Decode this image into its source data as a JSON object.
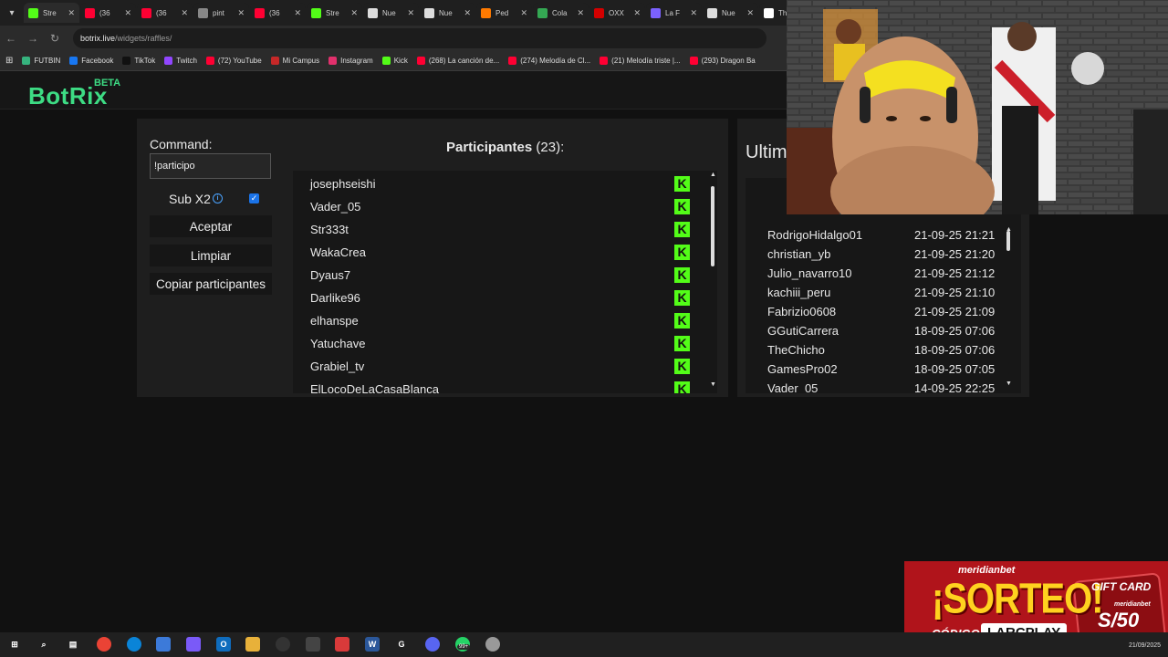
{
  "browser": {
    "tabs": [
      {
        "title": "Stre",
        "icon": "kick-icon",
        "color": "#53fc18"
      },
      {
        "title": "(36",
        "icon": "youtube-icon",
        "color": "#ff0033"
      },
      {
        "title": "(36",
        "icon": "youtube-icon",
        "color": "#ff0033"
      },
      {
        "title": "pint",
        "icon": "globe-icon",
        "color": "#888888"
      },
      {
        "title": "(36",
        "icon": "youtube-icon",
        "color": "#ff0033"
      },
      {
        "title": "Stre",
        "icon": "kick-icon",
        "color": "#53fc18"
      },
      {
        "title": "Nue",
        "icon": "github-icon",
        "color": "#dddddd"
      },
      {
        "title": "Nue",
        "icon": "github-icon",
        "color": "#dddddd"
      },
      {
        "title": "Ped",
        "icon": "order-icon",
        "color": "#ff7a00"
      },
      {
        "title": "Cola",
        "icon": "chart-icon",
        "color": "#34a853"
      },
      {
        "title": "OXX",
        "icon": "oxxo-icon",
        "color": "#d40000"
      },
      {
        "title": "La F",
        "icon": "globe-icon",
        "color": "#7b61ff"
      },
      {
        "title": "Nue",
        "icon": "github-icon",
        "color": "#dddddd"
      },
      {
        "title": "The",
        "icon": "diamond-icon",
        "color": "#ffffff"
      }
    ],
    "url_domain": "botrix.live",
    "url_path": "/widgets/raffles/",
    "bookmarks": [
      {
        "label": "FUTBIN",
        "color": "#36b37e"
      },
      {
        "label": "Facebook",
        "color": "#1877f2"
      },
      {
        "label": "TikTok",
        "color": "#111111"
      },
      {
        "label": "Twitch",
        "color": "#9146ff"
      },
      {
        "label": "(72) YouTube",
        "color": "#ff0033"
      },
      {
        "label": "Mi Campus",
        "color": "#c62828"
      },
      {
        "label": "Instagram",
        "color": "#e1306c"
      },
      {
        "label": "Kick",
        "color": "#53fc18"
      },
      {
        "label": "(268) La canción de...",
        "color": "#ff0033"
      },
      {
        "label": "(274) Melodía de Cl...",
        "color": "#ff0033"
      },
      {
        "label": "(21) Melodía triste |...",
        "color": "#ff0033"
      },
      {
        "label": "(293) Dragon Ba",
        "color": "#ff0033"
      }
    ]
  },
  "site": {
    "logo": "BotRix",
    "beta": "BETA"
  },
  "raffle": {
    "command_label": "Command:",
    "command_value": "!participo",
    "subx2_label": "Sub X2",
    "subx2_checked": true,
    "accept_label": "Aceptar",
    "clear_label": "Limpiar",
    "copy_label": "Copiar participantes",
    "participants_title": "Participantes",
    "participants_count": "(23):",
    "participants": [
      "josephseishi",
      "Vader_05",
      "Str333t",
      "WakaCrea",
      "Dyaus7",
      "Darlike96",
      "elhanspe",
      "Yatuchave",
      "Grabiel_tv",
      "ElLocoDeLaCasaBlanca"
    ],
    "platform_badge": "K",
    "platform_color": "#53fc18"
  },
  "winners": {
    "title": "Ultim",
    "rows": [
      {
        "name": "RodrigoHidalgo01",
        "date": "21-09-25 21:21"
      },
      {
        "name": "christian_yb",
        "date": "21-09-25 21:20"
      },
      {
        "name": "Julio_navarro10",
        "date": "21-09-25 21:12"
      },
      {
        "name": "kachiii_peru",
        "date": "21-09-25 21:10"
      },
      {
        "name": "Fabrizio0608",
        "date": "21-09-25 21:09"
      },
      {
        "name": "GGutiCarrera",
        "date": "18-09-25 07:06"
      },
      {
        "name": "TheChicho",
        "date": "18-09-25 07:06"
      },
      {
        "name": "GamesPro02",
        "date": "18-09-25 07:05"
      },
      {
        "name": "Vader_05",
        "date": "14-09-25 22:25"
      }
    ]
  },
  "promo": {
    "brand": "meridianbet",
    "headline": "¡SORTEO!",
    "code_label": "CÓDIGO:",
    "code": "LARCPLAY",
    "gift_label": "GIFT CARD",
    "card_brand": "meridianbet",
    "amount": "S/50"
  },
  "taskbar": {
    "date": "21/09/2025",
    "notification_badge": "99+"
  }
}
